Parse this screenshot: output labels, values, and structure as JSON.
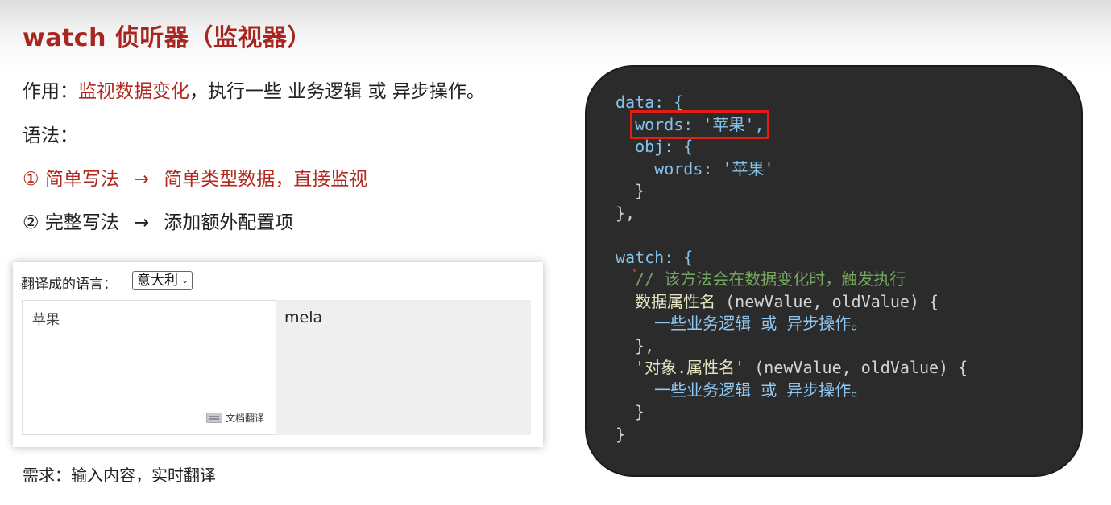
{
  "slide": {
    "title": "watch 侦听器（监视器）"
  },
  "points": {
    "purpose_label": "作用：",
    "purpose_highlight": "监视数据变化",
    "purpose_rest": "，执行一些 业务逻辑 或 异步操作。",
    "syntax_label": "语法：",
    "item1_left": "① 简单写法",
    "item1_arrow": "→",
    "item1_right": "简单类型数据，直接监视",
    "item2_left": "② 完整写法",
    "item2_arrow": "→",
    "item2_right": "添加额外配置项"
  },
  "demo": {
    "label": "翻译成的语言：",
    "language_selected": "意大利",
    "source_text": "苹果",
    "doc_translate_label": "文档翻译",
    "output_text": "mela"
  },
  "footnote": "需求：输入内容，实时翻译",
  "code": {
    "l1": "data: {",
    "l2": "words: '苹果',",
    "l3": "obj: {",
    "l4": "words: '苹果'",
    "l5": "}",
    "l6": "},",
    "l7": "",
    "l8": "watch: {",
    "l9": "// 该方法会在数据变化时，触发执行",
    "l10a": "数据属性名",
    "l10b": " (newValue, oldValue) {",
    "l11": "一些业务逻辑 或 异步操作。",
    "l12": "},",
    "l13a": "'对象.属性名'",
    "l13b": " (newValue, oldValue) {",
    "l14": "一些业务逻辑 或 异步操作。",
    "l15": "}",
    "l16": "}"
  },
  "colors": {
    "title_red": "#a8261f",
    "highlight_red": "#b1281f",
    "code_bg": "#2b2b2b",
    "box_outline": "#e21d12",
    "comment_green": "#74a85e"
  }
}
